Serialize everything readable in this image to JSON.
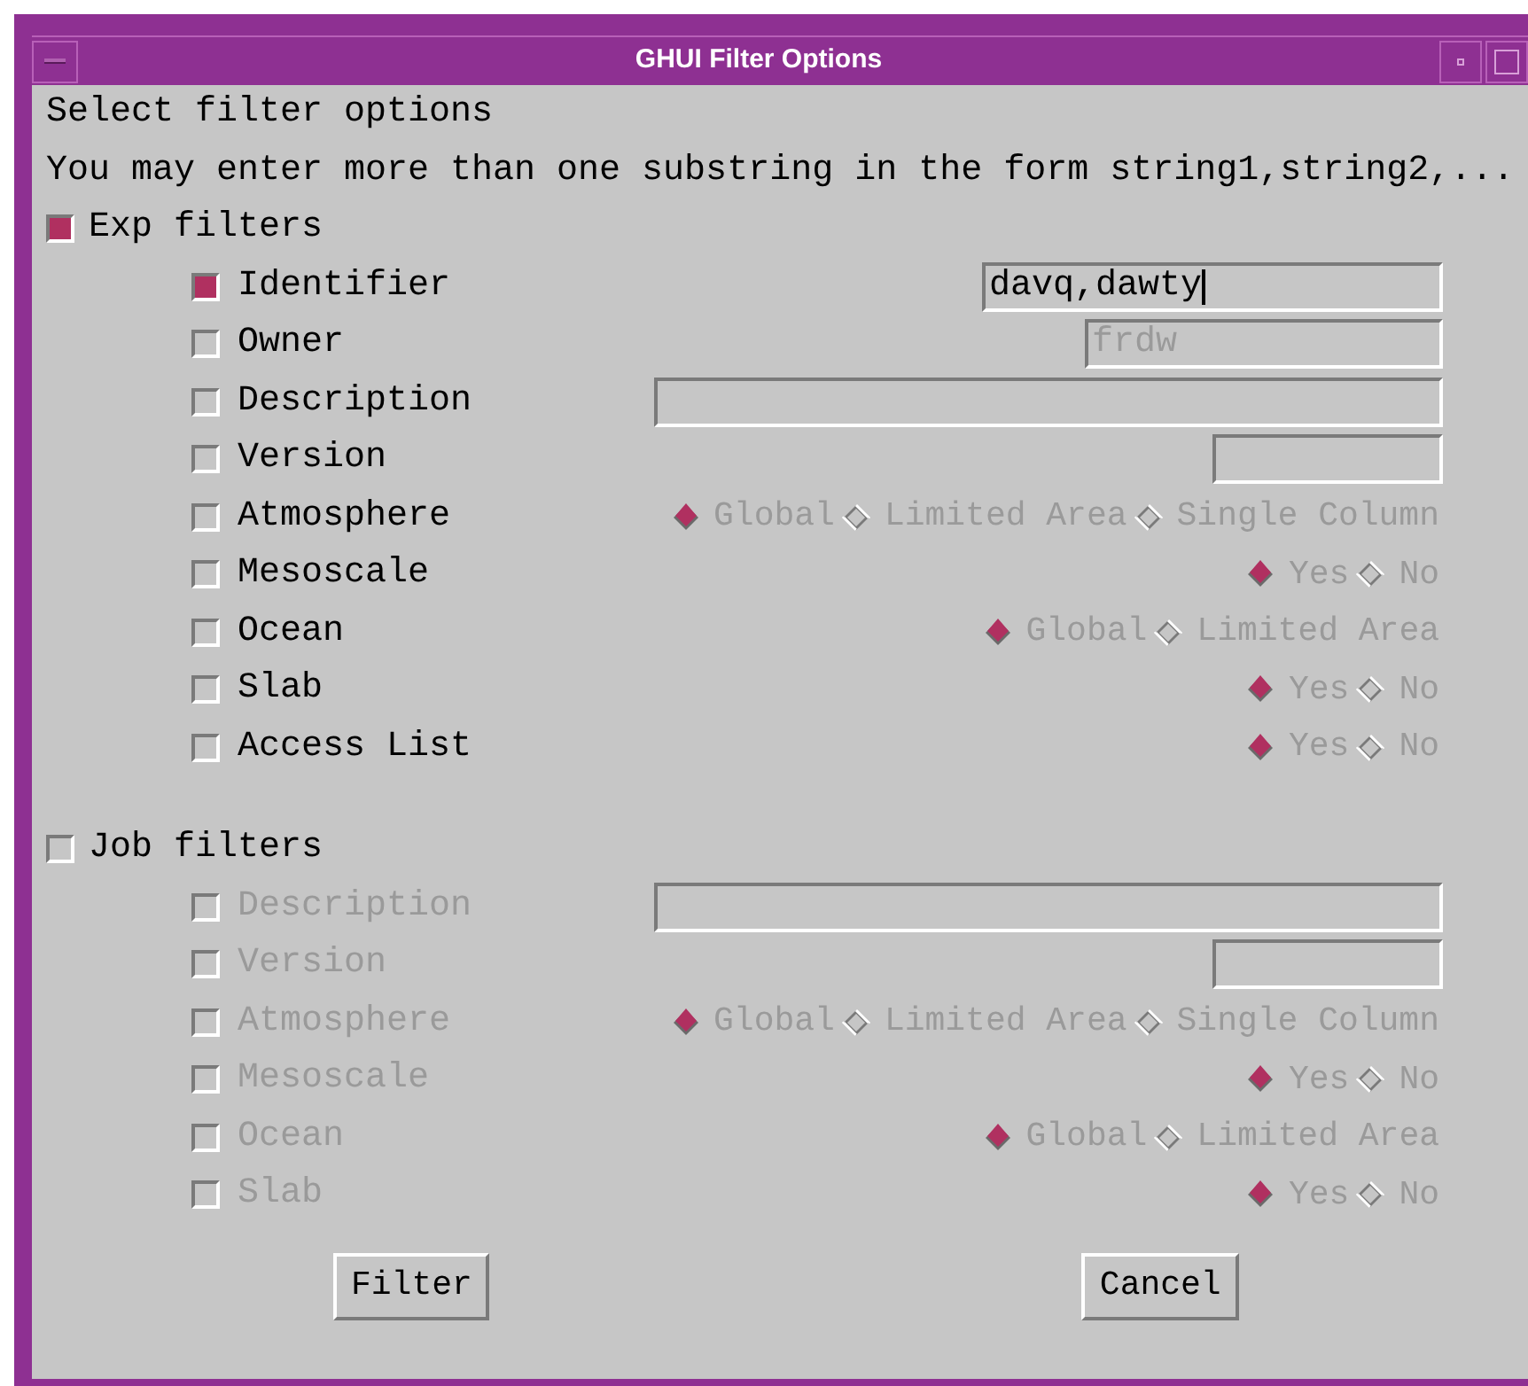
{
  "window": {
    "title": "GHUI Filter Options"
  },
  "intro": [
    "Select filter options",
    "You may enter more than one substring in the form string1,string2,..."
  ],
  "sections": [
    {
      "label": "Exp filters",
      "checked": true,
      "items": [
        {
          "kind": "text",
          "label": "Identifier",
          "checked": true,
          "value": "davq,dawty"
        },
        {
          "kind": "text",
          "label": "Owner",
          "checked": false,
          "value": "frdw"
        },
        {
          "kind": "text",
          "label": "Description",
          "checked": false
        },
        {
          "kind": "text",
          "label": "Version",
          "checked": false
        },
        {
          "kind": "radio",
          "label": "Atmosphere",
          "checked": false,
          "options": [
            {
              "label": "Global",
              "selected": true
            },
            {
              "label": "Limited Area",
              "selected": false
            },
            {
              "label": "Single Column",
              "selected": false
            }
          ]
        },
        {
          "kind": "radio",
          "label": "Mesoscale",
          "checked": false,
          "options": [
            {
              "label": "Yes",
              "selected": true
            },
            {
              "label": "No",
              "selected": false
            }
          ]
        },
        {
          "kind": "radio",
          "label": "Ocean",
          "checked": false,
          "options": [
            {
              "label": "Global",
              "selected": true
            },
            {
              "label": "Limited Area",
              "selected": false
            }
          ]
        },
        {
          "kind": "radio",
          "label": "Slab",
          "checked": false,
          "options": [
            {
              "label": "Yes",
              "selected": true
            },
            {
              "label": "No",
              "selected": false
            }
          ]
        },
        {
          "kind": "radio",
          "label": "Access List",
          "checked": false,
          "options": [
            {
              "label": "Yes",
              "selected": true
            },
            {
              "label": "No",
              "selected": false
            }
          ]
        }
      ]
    },
    {
      "label": "Job filters",
      "checked": false,
      "items": [
        {
          "kind": "text",
          "label": "Description",
          "checked": false
        },
        {
          "kind": "text",
          "label": "Version",
          "checked": false
        },
        {
          "kind": "radio",
          "label": "Atmosphere",
          "checked": false,
          "options": [
            {
              "label": "Global",
              "selected": true
            },
            {
              "label": "Limited Area",
              "selected": false
            },
            {
              "label": "Single Column",
              "selected": false
            }
          ]
        },
        {
          "kind": "radio",
          "label": "Mesoscale",
          "checked": false,
          "options": [
            {
              "label": "Yes",
              "selected": true
            },
            {
              "label": "No",
              "selected": false
            }
          ]
        },
        {
          "kind": "radio",
          "label": "Ocean",
          "checked": false,
          "options": [
            {
              "label": "Global",
              "selected": true
            },
            {
              "label": "Limited Area",
              "selected": false
            }
          ]
        },
        {
          "kind": "radio",
          "label": "Slab",
          "checked": false,
          "options": [
            {
              "label": "Yes",
              "selected": true
            },
            {
              "label": "No",
              "selected": false
            }
          ]
        }
      ]
    }
  ],
  "buttons": [
    "Filter",
    "Cancel"
  ]
}
